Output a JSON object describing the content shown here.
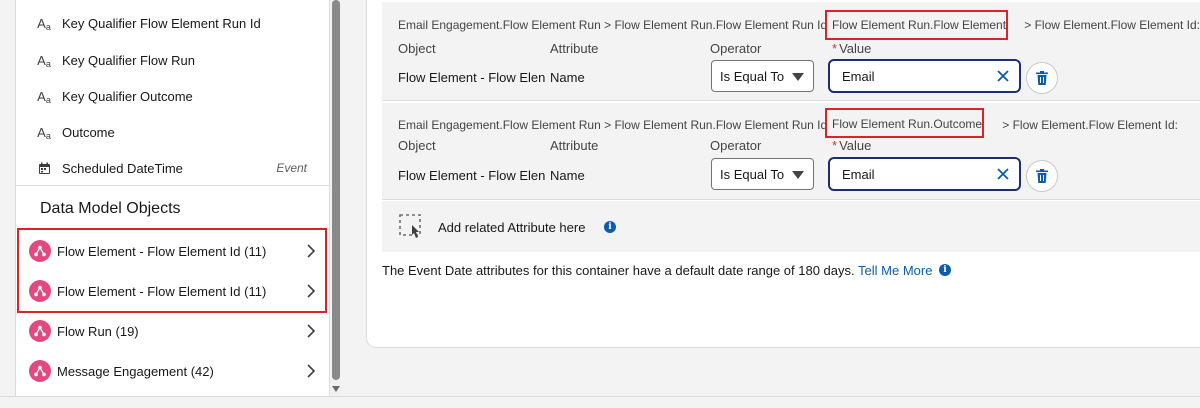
{
  "attributes": [
    {
      "label": "Key Qualifier Flow Element Run Id",
      "icon": "text-type-icon",
      "tag": ""
    },
    {
      "label": "Key Qualifier Flow Run",
      "icon": "text-type-icon",
      "tag": ""
    },
    {
      "label": "Key Qualifier Outcome",
      "icon": "text-type-icon",
      "tag": ""
    },
    {
      "label": "Outcome",
      "icon": "text-type-icon",
      "tag": ""
    },
    {
      "label": "Scheduled DateTime",
      "icon": "calendar-icon",
      "tag": "Event"
    }
  ],
  "section_title": "Data Model Objects",
  "dmo_items": [
    {
      "label": "Flow Element - Flow Element Id (11)"
    },
    {
      "label": "Flow Element - Flow Element Id (11)"
    },
    {
      "label": "Flow Run (19)"
    },
    {
      "label": "Message Engagement (42)"
    }
  ],
  "filters": [
    {
      "path_prefix": "Email Engagement.Flow Element Run > Flow Element Run.Flow Element Run Id >",
      "path_highlight": "Flow Element Run.Flow Element",
      "path_suffix": "> Flow Element.Flow Element Id:",
      "headers": {
        "object": "Object",
        "attribute": "Attribute",
        "operator": "Operator",
        "value": "Value",
        "required_mark": "*"
      },
      "object": "Flow Element - Flow Elen",
      "attribute": "Name",
      "operator": "Is Equal To",
      "value": "Email"
    },
    {
      "path_prefix": "Email Engagement.Flow Element Run > Flow Element Run.Flow Element Run Id >",
      "path_highlight": "Flow Element Run.Outcome",
      "path_suffix": "> Flow Element.Flow Element Id:",
      "headers": {
        "object": "Object",
        "attribute": "Attribute",
        "operator": "Operator",
        "value": "Value",
        "required_mark": "*"
      },
      "object": "Flow Element - Flow Elen",
      "attribute": "Name",
      "operator": "Is Equal To",
      "value": "Email"
    }
  ],
  "add_related_label": "Add related Attribute here",
  "info_glyph": "i",
  "footnote": {
    "text": "The Event Date attributes for this container have a default date range of 180 days.",
    "link": "Tell Me More"
  },
  "colors": {
    "highlight": "#d8232a",
    "dmo_icon": "#e3497e",
    "link": "#0b5cab",
    "input_focus": "#1b2f6e"
  }
}
